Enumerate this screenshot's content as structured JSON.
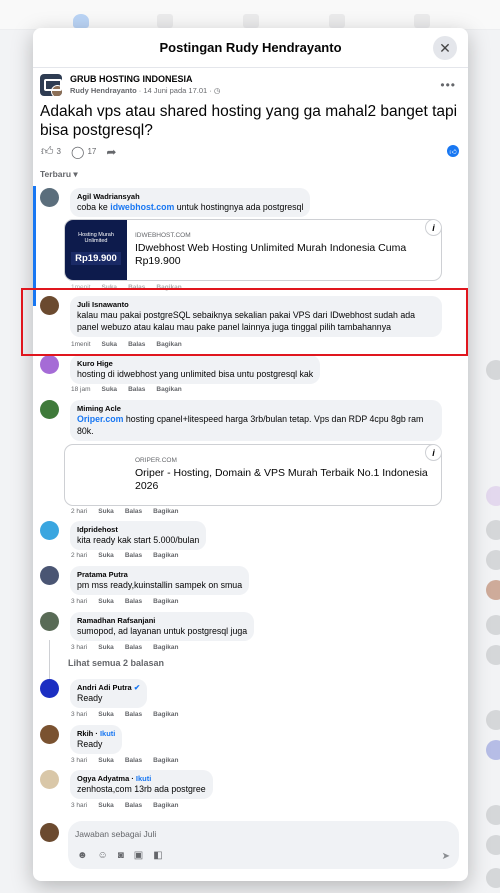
{
  "modal": {
    "title": "Postingan Rudy Hendrayanto",
    "close": "✕"
  },
  "post": {
    "group_name": "GRUB HOSTING INDONESIA",
    "author": "Rudy Hendrayanto",
    "date": "14 Juni pada 17.01",
    "privacy_icon": "◷",
    "text": "Adakah vps atau shared hosting yang ga mahal2 banget tapi bisa postgresql?",
    "likes": "3",
    "comments": "17"
  },
  "sort_label": "Terbaru",
  "comments": [
    {
      "name": "Agil Wadriansyah",
      "text_before": "coba ke ",
      "link": "idwebhost.com",
      "text_after": " untuk hostingnya ada postgresql",
      "time": "1menit",
      "suka": "Suka",
      "balas": "Balas",
      "bagikan": "Bagikan"
    },
    {
      "name": "Juli Isnawanto",
      "text": "kalau mau pakai postgreSQL sebaiknya sekalian pakai VPS dari IDwebhost sudah ada panel webuzo atau kalau mau pake panel lainnya juga tinggal pilih tambahannya",
      "time": "1menit",
      "suka": "Suka",
      "balas": "Balas",
      "bagikan": "Bagikan"
    },
    {
      "name": "Kuro Hige",
      "text": "hosting di idwebhost yang unlimited bisa untu postgresql kak",
      "time": "18 jam",
      "suka": "Suka",
      "balas": "Balas",
      "bagikan": "Bagikan"
    },
    {
      "name": "Miming Acle",
      "link": "Oriper.com",
      "text_after": " hosting cpanel+litespeed harga 3rb/bulan tetap. Vps dan RDP 4cpu 8gb ram 80k.",
      "time": "2 hari",
      "suka": "Suka",
      "balas": "Balas",
      "bagikan": "Bagikan"
    },
    {
      "name": "Idpridehost",
      "text": "kita ready kak start 5.000/bulan",
      "time": "2 hari",
      "suka": "Suka",
      "balas": "Balas",
      "bagikan": "Bagikan"
    },
    {
      "name": "Pratama Putra",
      "text": "pm mss ready,kuinstallin sampek on smua",
      "time": "3 hari",
      "suka": "Suka",
      "balas": "Balas",
      "bagikan": "Bagikan"
    },
    {
      "name": "Ramadhan Rafsanjani",
      "text": "sumopod, ad layanan untuk postgresql juga",
      "time": "3 hari",
      "suka": "Suka",
      "balas": "Balas",
      "bagikan": "Bagikan"
    },
    {
      "name": "Andri Adi Putra",
      "text": "Ready",
      "time": "3 hari",
      "suka": "Suka",
      "balas": "Balas",
      "bagikan": "Bagikan"
    },
    {
      "name": "Rkih",
      "ikuti": "Ikuti",
      "text": "Ready",
      "time": "3 hari",
      "suka": "Suka",
      "balas": "Balas",
      "bagikan": "Bagikan"
    },
    {
      "name": "Ogya Adyatma",
      "ikuti": "Ikuti",
      "text": "zenhosta,com 13rb ada postgree",
      "time": "3 hari",
      "suka": "Suka",
      "balas": "Balas",
      "bagikan": "Bagikan"
    }
  ],
  "card1": {
    "domain": "IDWEBHOST.COM",
    "title": "IDwebhost Web Hosting Unlimited Murah Indonesia Cuma Rp19.900",
    "thumb_line1": "Hosting Murah",
    "thumb_line2": "Unlimited",
    "thumb_price": "Rp19.900"
  },
  "card2": {
    "domain": "ORIPER.COM",
    "title": "Oriper - Hosting, Domain & VPS Murah Terbaik No.1 Indonesia 2026"
  },
  "see_replies": "Lihat semua 2 balasan",
  "composer": {
    "placeholder": "Jawaban sebagai Juli"
  },
  "colors": {
    "accent": "#1877f2",
    "highlight": "#e0161e"
  }
}
